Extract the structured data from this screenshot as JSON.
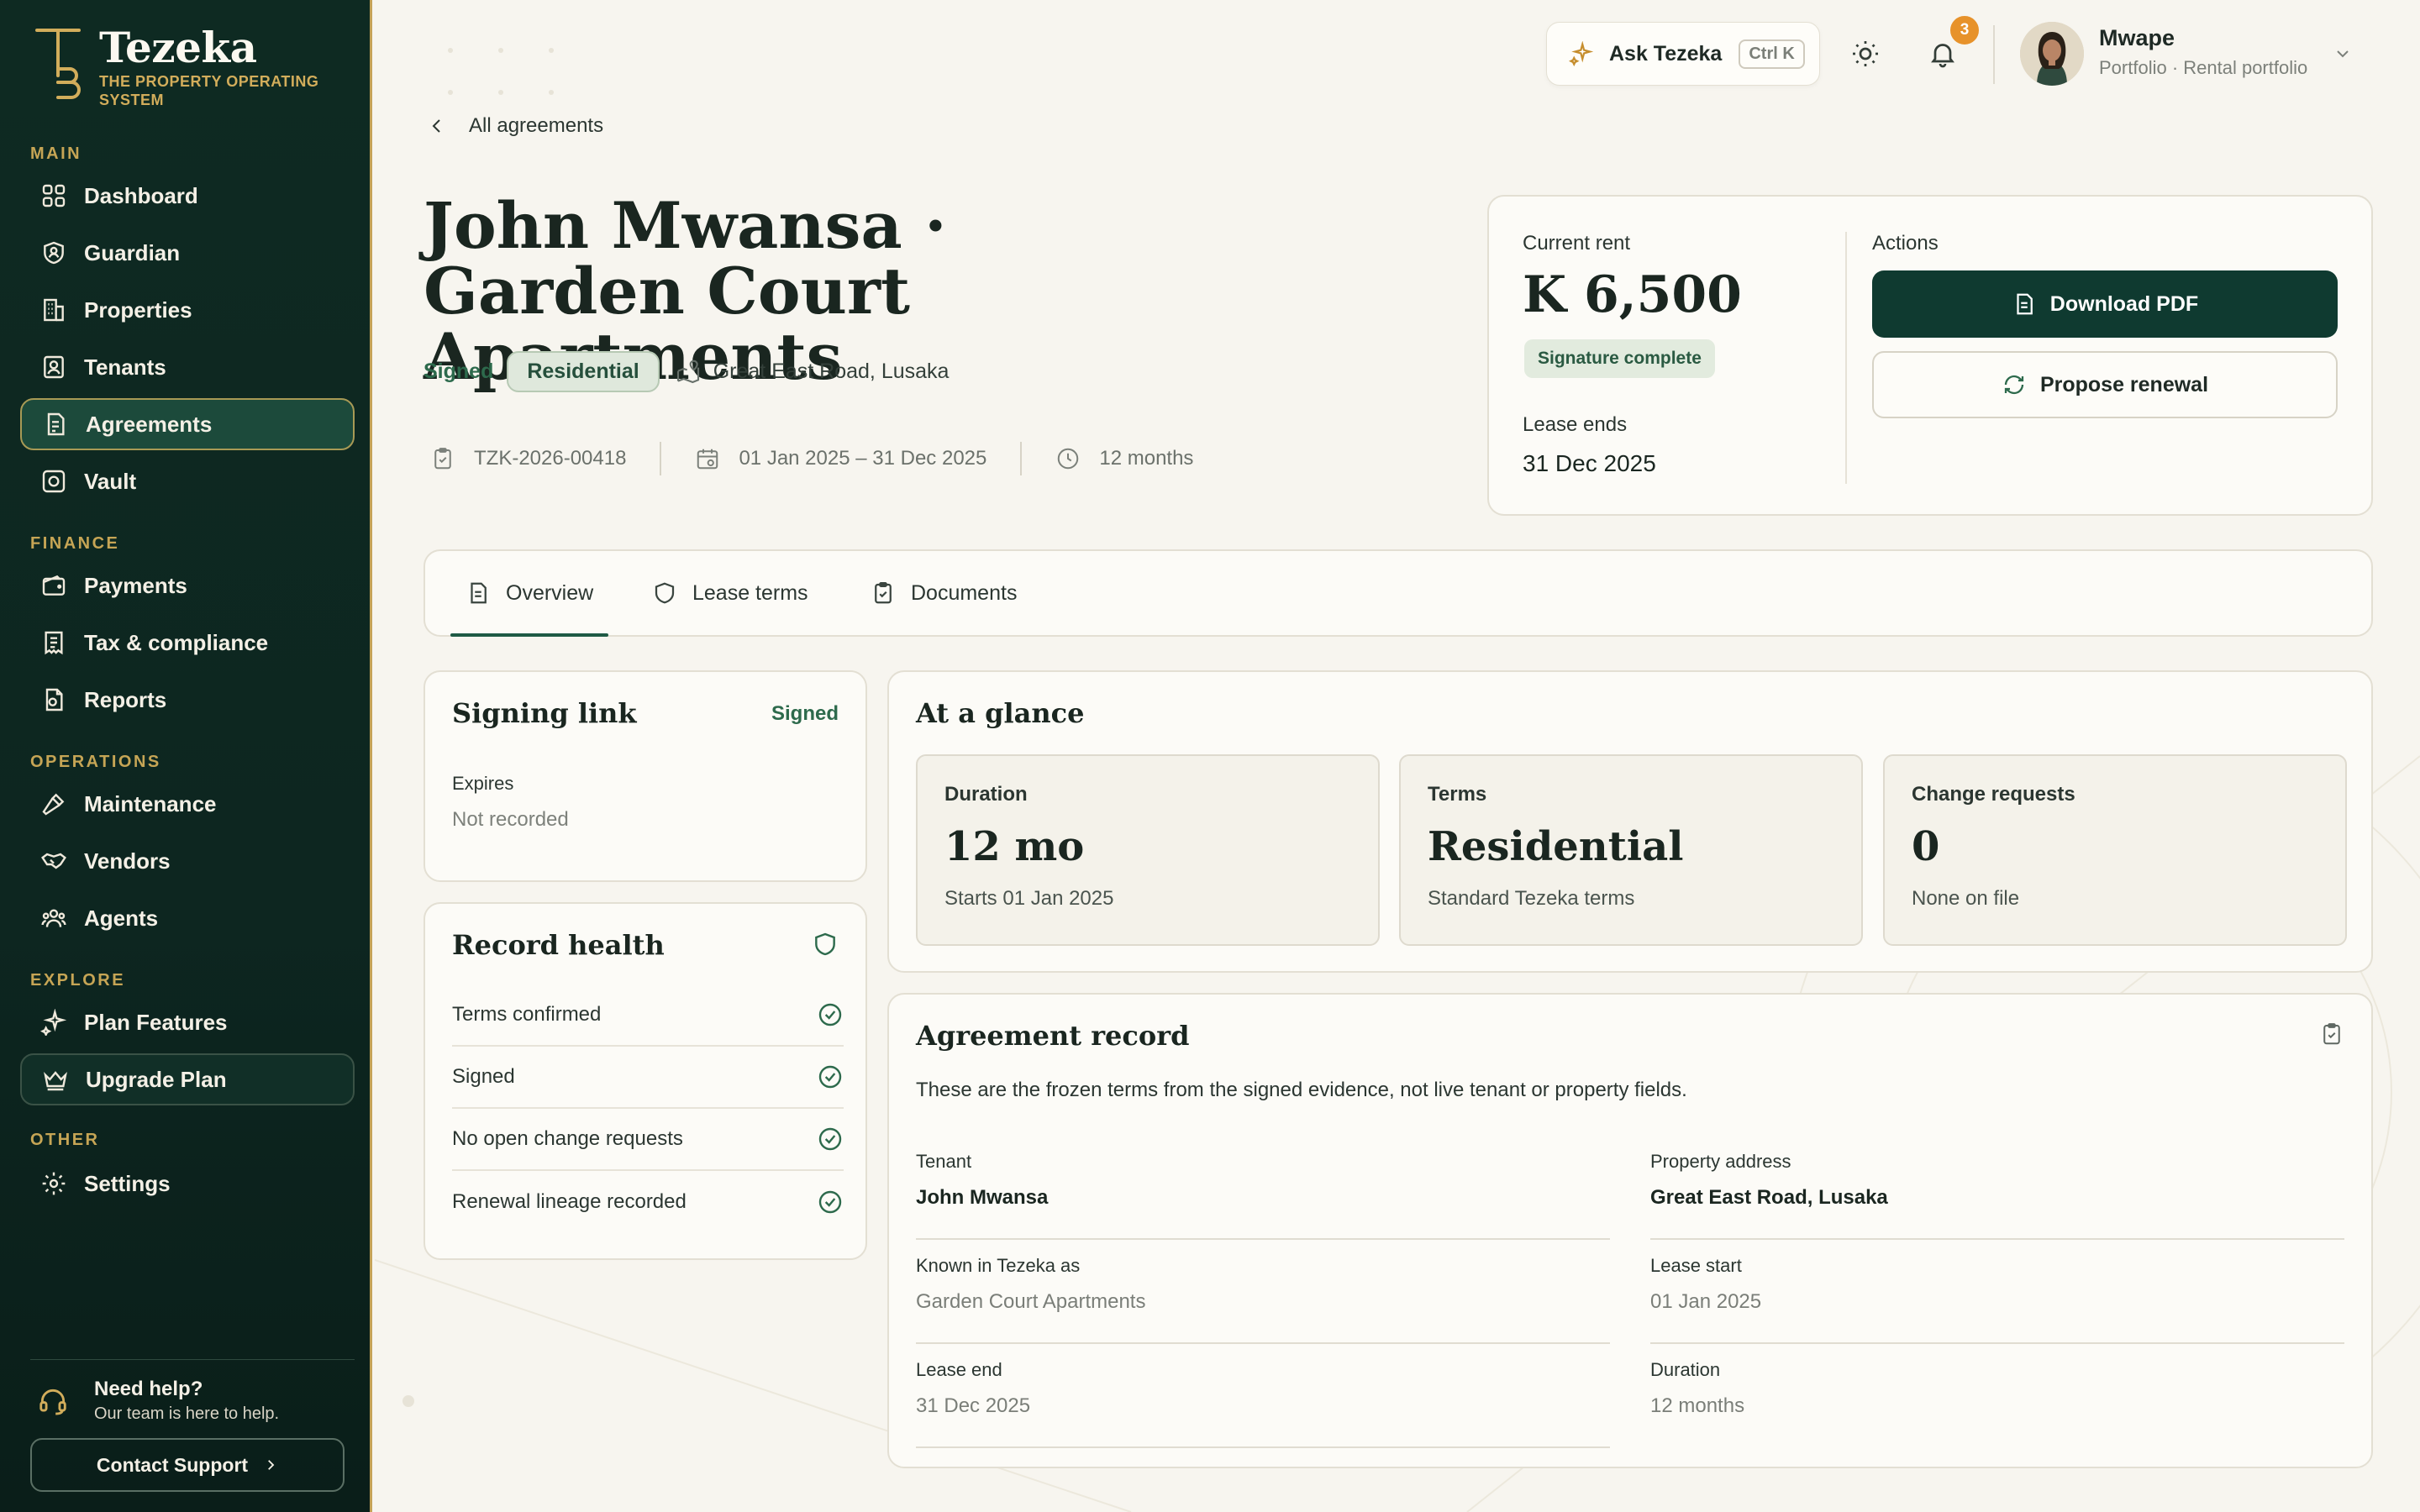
{
  "brand": {
    "name": "Tezeka",
    "tagline": "THE PROPERTY OPERATING SYSTEM"
  },
  "sidebar": {
    "sections": {
      "main": "MAIN",
      "finance": "FINANCE",
      "operations": "OPERATIONS",
      "explore": "EXPLORE",
      "other": "OTHER"
    },
    "items": {
      "dashboard": "Dashboard",
      "guardian": "Guardian",
      "properties": "Properties",
      "tenants": "Tenants",
      "agreements": "Agreements",
      "vault": "Vault",
      "payments": "Payments",
      "tax": "Tax & compliance",
      "reports": "Reports",
      "maintenance": "Maintenance",
      "vendors": "Vendors",
      "agents": "Agents",
      "plan_features": "Plan Features",
      "upgrade": "Upgrade Plan",
      "settings": "Settings"
    },
    "active_item": "agreements",
    "help": {
      "title": "Need help?",
      "subtitle": "Our team is here to help.",
      "button": "Contact Support"
    }
  },
  "topbar": {
    "ask_label": "Ask Tezeka",
    "ask_shortcut": "Ctrl K",
    "notification_count": "3",
    "user_name": "Mwape",
    "user_sub": "Portfolio · Rental portfolio"
  },
  "header": {
    "back_label": "All agreements",
    "title": "John Mwansa · Garden Court Apartments",
    "status": "Signed",
    "type_pill": "Residential",
    "address": "Great East Road, Lusaka",
    "reference": "TZK-2026-00418",
    "date_range": "01 Jan 2025 – 31 Dec 2025",
    "duration": "12 months"
  },
  "rent_card": {
    "rent_label": "Current rent",
    "rent_value": "K 6,500",
    "signature_badge": "Signature complete",
    "lease_ends_label": "Lease ends",
    "lease_ends_value": "31 Dec 2025",
    "actions_label": "Actions",
    "download_label": "Download PDF",
    "renew_label": "Propose renewal"
  },
  "tabs": [
    {
      "label": "Overview",
      "active": true
    },
    {
      "label": "Lease terms",
      "active": false
    },
    {
      "label": "Documents",
      "active": false
    }
  ],
  "signing_link": {
    "title": "Signing link",
    "status": "Signed",
    "expires_label": "Expires",
    "expires_value": "Not recorded"
  },
  "record_health": {
    "title": "Record health",
    "checks": [
      "Terms confirmed",
      "Signed",
      "No open change requests",
      "Renewal lineage recorded"
    ]
  },
  "at_a_glance": {
    "title": "At a glance",
    "tiles": [
      {
        "label": "Duration",
        "value": "12 mo",
        "sub": "Starts 01 Jan 2025"
      },
      {
        "label": "Terms",
        "value": "Residential",
        "sub": "Standard Tezeka terms"
      },
      {
        "label": "Change requests",
        "value": "0",
        "sub": "None on file"
      }
    ]
  },
  "agreement_record": {
    "title": "Agreement record",
    "description": "These are the frozen terms from the signed evidence, not live tenant or property fields.",
    "fields": [
      {
        "label": "Tenant",
        "value": "John Mwansa",
        "emphasis": true
      },
      {
        "label": "Property address",
        "value": "Great East Road, Lusaka",
        "emphasis": true
      },
      {
        "label": "Known in Tezeka as",
        "value": "Garden Court Apartments",
        "emphasis": false
      },
      {
        "label": "Lease start",
        "value": "01 Jan 2025",
        "emphasis": false
      },
      {
        "label": "Lease end",
        "value": "31 Dec 2025",
        "emphasis": false
      },
      {
        "label": "Duration",
        "value": "12 months",
        "emphasis": false
      }
    ]
  },
  "colors": {
    "sidebar_bg": "#0e2a22",
    "accent_gold": "#c6a555",
    "primary_green": "#0f3a30",
    "success_green": "#2d6a4c",
    "badge_orange": "#e7922a",
    "page_bg": "#f7f5ef"
  }
}
